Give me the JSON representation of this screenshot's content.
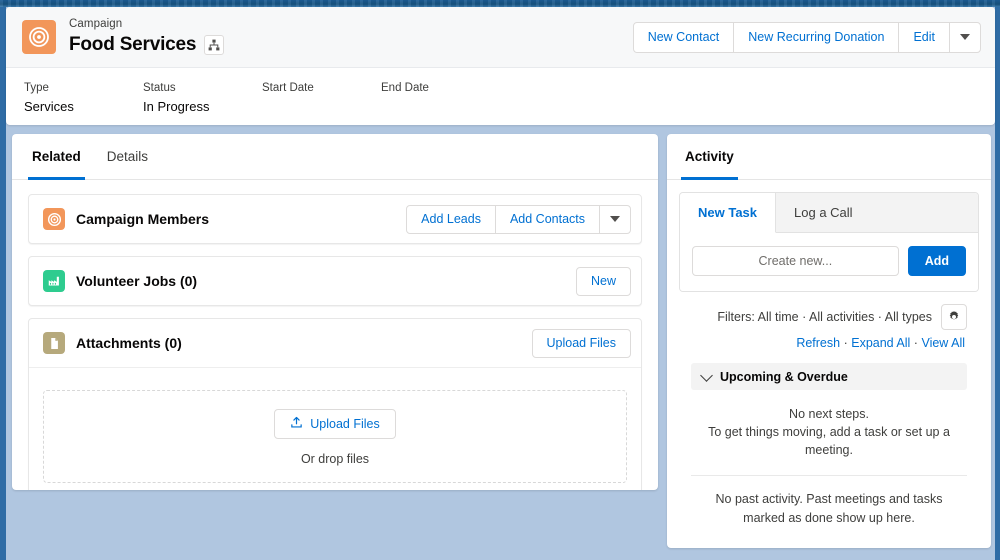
{
  "header": {
    "eyebrow": "Campaign",
    "title": "Food Services",
    "hierarchy_icon": "hierarchy-icon",
    "record_icon": "campaign-target-icon",
    "actions": [
      {
        "label": "New Contact",
        "name": "new-contact-button"
      },
      {
        "label": "New Recurring Donation",
        "name": "new-recurring-donation-button"
      },
      {
        "label": "Edit",
        "name": "edit-button"
      }
    ],
    "more_actions_icon": "chevron-down-icon",
    "fields": [
      {
        "label": "Type",
        "value": "Services"
      },
      {
        "label": "Status",
        "value": "In Progress"
      },
      {
        "label": "Start Date",
        "value": ""
      },
      {
        "label": "End Date",
        "value": ""
      }
    ]
  },
  "left_panel": {
    "tabs": [
      {
        "label": "Related",
        "active": true
      },
      {
        "label": "Details",
        "active": false
      }
    ],
    "cards": [
      {
        "title": "Campaign Members",
        "icon": "campaign-target-icon",
        "icon_color": "#f2965a",
        "buttons": [
          {
            "label": "Add Leads",
            "name": "add-leads-button"
          },
          {
            "label": "Add Contacts",
            "name": "add-contacts-button"
          }
        ],
        "has_caret": true
      },
      {
        "title": "Volunteer Jobs (0)",
        "icon": "volunteer-jobs-icon",
        "icon_color": "#2ecc8f",
        "buttons": [
          {
            "label": "New",
            "name": "new-volunteer-job-button"
          }
        ],
        "has_caret": false
      },
      {
        "title": "Attachments (0)",
        "icon": "attachment-file-icon",
        "icon_color": "#b6a97c",
        "buttons": [
          {
            "label": "Upload Files",
            "name": "upload-files-button"
          }
        ],
        "has_caret": false
      }
    ],
    "dropzone": {
      "upload_label": "Upload Files",
      "upload_icon": "upload-arrow-icon",
      "or_drop_label": "Or drop files"
    }
  },
  "right_panel": {
    "tab_label": "Activity",
    "composer": {
      "tabs": [
        {
          "label": "New Task",
          "active": true
        },
        {
          "label": "Log a Call",
          "active": false
        }
      ],
      "input_placeholder": "Create new...",
      "input_value": "",
      "add_label": "Add"
    },
    "filters": {
      "text": "Filters: All time · All activities · All types",
      "gear_icon": "gear-icon"
    },
    "links": {
      "refresh": "Refresh",
      "expand_all": "Expand All",
      "view_all": "View All",
      "separator": "·"
    },
    "section": {
      "label": "Upcoming & Overdue",
      "chevron_icon": "chevron-down-icon"
    },
    "empty_upcoming_line1": "No next steps.",
    "empty_upcoming_line2": "To get things moving, add a task or set up a meeting.",
    "empty_past": "No past activity. Past meetings and tasks marked as done show up here."
  },
  "colors": {
    "accent_blue": "#0070d2",
    "campaign_orange": "#f2965a",
    "volunteer_green": "#2ecc8f",
    "attachment_tan": "#b6a97c",
    "page_background": "#b0c6e0",
    "frame_blue": "#2f6ca5"
  }
}
